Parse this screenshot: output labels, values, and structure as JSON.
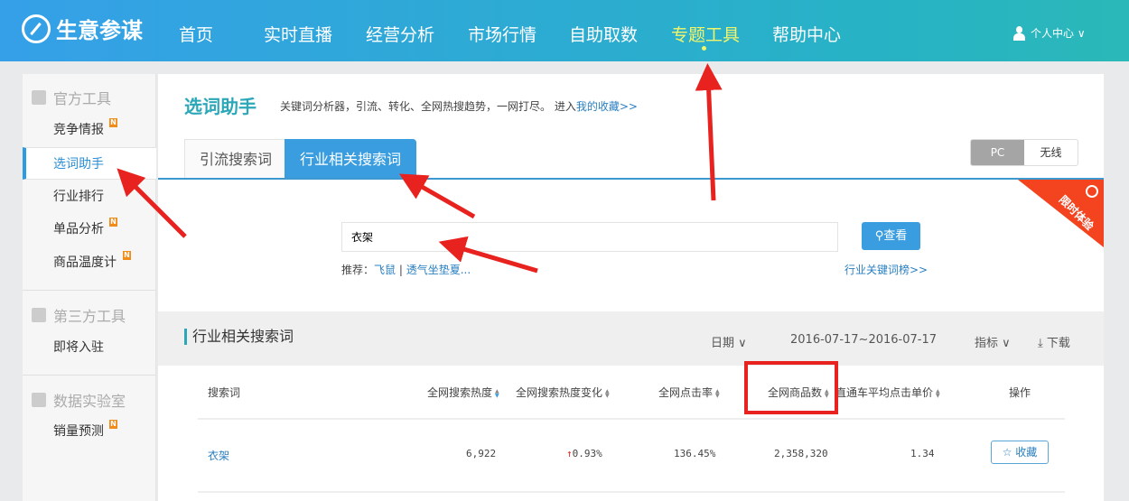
{
  "header": {
    "logo": "生意参谋",
    "nav": [
      "首页",
      "实时直播",
      "经营分析",
      "市场行情",
      "自助取数",
      "专题工具",
      "帮助中心"
    ],
    "active_nav": "专题工具",
    "user": "个人中心 ∨"
  },
  "sidebar": {
    "groups": [
      {
        "label": "官方工具",
        "items": [
          {
            "label": "竞争情报",
            "badge": "N"
          },
          {
            "label": "选词助手",
            "active": true
          },
          {
            "label": "行业排行"
          },
          {
            "label": "单品分析",
            "badge": "N"
          },
          {
            "label": "商品温度计",
            "badge": "N"
          }
        ]
      },
      {
        "label": "第三方工具",
        "items": [
          {
            "label": "即将入驻"
          }
        ]
      },
      {
        "label": "数据实验室",
        "items": [
          {
            "label": "销量预测",
            "badge": "N"
          }
        ]
      }
    ]
  },
  "page": {
    "title": "选词助手",
    "desc": "关键词分析器，引流、转化、全网热搜趋势，一网打尽。 进入",
    "fav_link": "我的收藏>>",
    "tabs": [
      "引流搜索词",
      "行业相关搜索词"
    ],
    "active_tab": "行业相关搜索词",
    "device": [
      "PC",
      "无线"
    ],
    "device_selected": "PC",
    "corner_badge": "限时体验",
    "search_value": "衣架",
    "search_button": "查看",
    "recommend_label": "推荐：",
    "recommend": [
      "飞鼠",
      "透气坐垫夏..."
    ],
    "rank_link": "行业关键词榜>>"
  },
  "table": {
    "title": "行业相关搜索词",
    "date_label": "日期",
    "date_range": "2016-07-17~2016-07-17",
    "metric_label": "指标",
    "download": "下载",
    "columns": [
      "搜索词",
      "全网搜索热度",
      "全网搜索热度变化",
      "全网点击率",
      "全网商品数",
      "直通车平均点击单价",
      "操作"
    ],
    "rows": [
      {
        "keyword": "衣架",
        "heat": "6,922",
        "change": "0.93%",
        "change_dir": "up",
        "ctr": "136.45%",
        "items": "2,358,320",
        "cpc": "1.34",
        "action": "收藏"
      }
    ]
  },
  "colors": {
    "accent": "#3a9de0",
    "title": "#2ba7b8",
    "annotation": "#e8221e",
    "up": "#e8221e"
  }
}
